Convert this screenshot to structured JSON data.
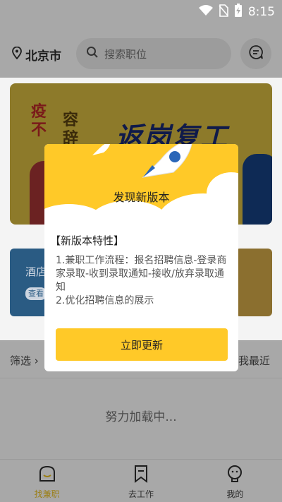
{
  "status_bar": {
    "time": "8:15",
    "icons": [
      "wifi-icon",
      "no-sim-icon",
      "battery-charging-icon"
    ]
  },
  "header": {
    "city": "北京市",
    "search_placeholder": "搜索职位"
  },
  "banner": {
    "title": "返岗复工",
    "left_lines": [
      "疫",
      "不",
      "容",
      "辞"
    ]
  },
  "card": {
    "title": "酒店",
    "badge": "查看"
  },
  "filter": {
    "left": "筛选",
    "right": "我最近"
  },
  "loading_text": "努力加载中...",
  "tabs": [
    {
      "label": "找兼职",
      "icon": "home-icon",
      "active": true
    },
    {
      "label": "去工作",
      "icon": "bookmark-icon",
      "active": false
    },
    {
      "label": "我的",
      "icon": "profile-icon",
      "active": false
    }
  ],
  "modal": {
    "title": "发现新版本",
    "feature_head": "【新版本特性】",
    "features": [
      "1.兼职工作流程：报名招聘信息-登录商家录取-收到录取通知-接收/放弃录取通知",
      "2.优化招聘信息的展示"
    ],
    "button": "立即更新"
  },
  "colors": {
    "accent": "#ffc928",
    "overlay": "#a8a8a8"
  }
}
